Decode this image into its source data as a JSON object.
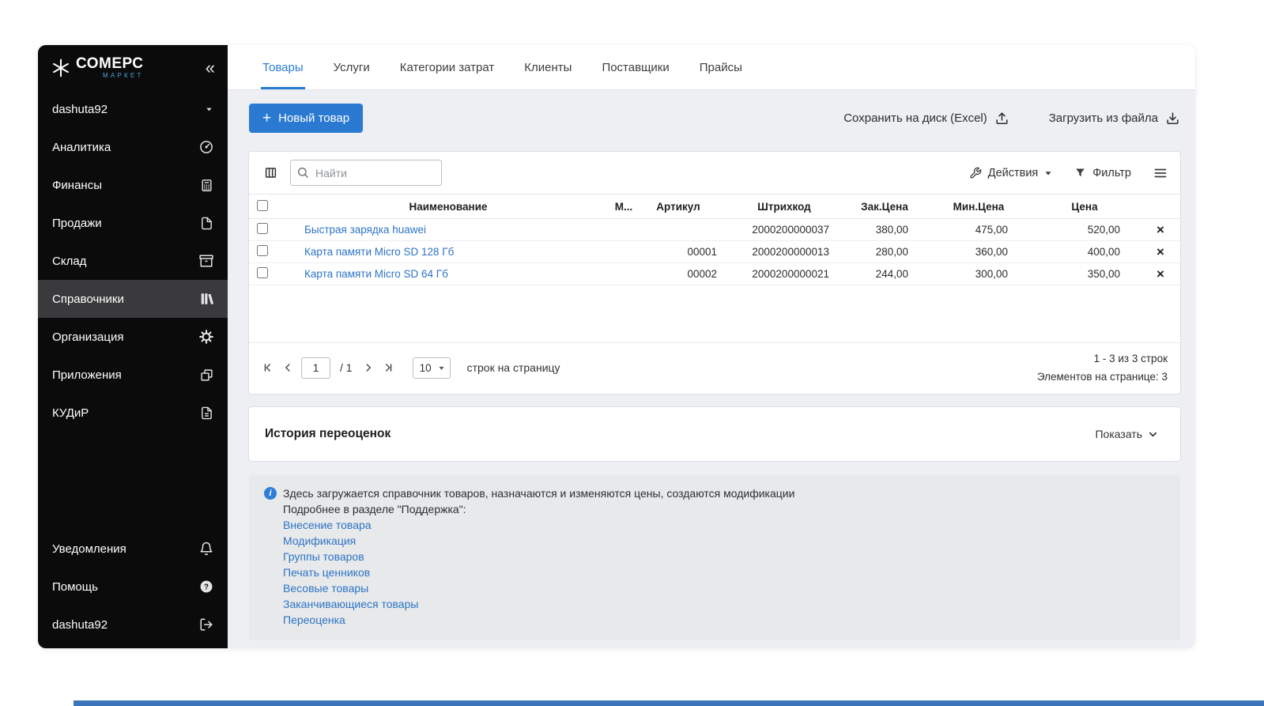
{
  "colors": {
    "accent": "#2b7cd3",
    "button_blue": "#2b7ad1",
    "link_blue": "#2d74c4",
    "sidebar_bg": "#0b0b0c",
    "info_box_bg": "#e7e9eb"
  },
  "sidebar": {
    "logo_title": "СОМЕРС",
    "logo_subtitle": "МАРКЕТ",
    "collapse_label": "«",
    "user_label": "dashuta92",
    "items": [
      {
        "label": "Аналитика",
        "icon": "gauge-icon"
      },
      {
        "label": "Финансы",
        "icon": "calculator-icon"
      },
      {
        "label": "Продажи",
        "icon": "document-icon"
      },
      {
        "label": "Склад",
        "icon": "archive-box-icon"
      },
      {
        "label": "Справочники",
        "icon": "books-icon",
        "active": true
      },
      {
        "label": "Организация",
        "icon": "gear-icon"
      },
      {
        "label": "Приложения",
        "icon": "apps-icon"
      },
      {
        "label": "КУДиР",
        "icon": "ledger-icon"
      }
    ],
    "bottom_items": [
      {
        "label": "Уведомления",
        "icon": "bell-icon"
      },
      {
        "label": "Помощь",
        "icon": "question-icon"
      },
      {
        "label": "dashuta92",
        "icon": "logout-icon"
      }
    ]
  },
  "tabs": [
    {
      "label": "Товары",
      "active": true
    },
    {
      "label": "Услуги"
    },
    {
      "label": "Категории затрат"
    },
    {
      "label": "Клиенты"
    },
    {
      "label": "Поставщики"
    },
    {
      "label": "Прайсы"
    }
  ],
  "actions": {
    "new_product_plus": "+",
    "new_product": "Новый товар",
    "save_excel": "Сохранить на диск (Excel)",
    "load_file": "Загрузить из файла"
  },
  "toolbar": {
    "search_placeholder": "Найти",
    "actions_label": "Действия",
    "filter_label": "Фильтр"
  },
  "table": {
    "headers": [
      "Наименование",
      "М...",
      "Артикул",
      "Штрихкод",
      "Зак.Цена",
      "Мин.Цена",
      "Цена"
    ],
    "delete_glyph": "×",
    "rows": [
      {
        "name": "Быстрая зарядка huawei",
        "mod": "",
        "article": "",
        "barcode": "2000200000037",
        "purchase_price": "380,00",
        "min_price": "475,00",
        "price": "520,00"
      },
      {
        "name": "Карта памяти Micro SD 128 Гб",
        "mod": "",
        "article": "00001",
        "barcode": "2000200000013",
        "purchase_price": "280,00",
        "min_price": "360,00",
        "price": "400,00"
      },
      {
        "name": "Карта памяти Micro SD 64 Гб",
        "mod": "",
        "article": "00002",
        "barcode": "2000200000021",
        "purchase_price": "244,00",
        "min_price": "300,00",
        "price": "350,00"
      }
    ]
  },
  "pagination": {
    "page": "1",
    "page_total_label": "/  1",
    "per_page": "10",
    "per_page_label": "строк на страницу",
    "rows_range": "1 - 3 из 3 строк",
    "per_page_info": "Элементов на странице: 3"
  },
  "history": {
    "title": "История переоценок",
    "toggle_label": "Показать"
  },
  "info": {
    "line1": "Здесь загружается справочник товаров, назначаются и изменяются цены, создаются модификации",
    "line2": "Подробнее в разделе \"Поддержка\":",
    "links": [
      "Внесение товара",
      "Модификация",
      "Группы товаров",
      "Печать ценников",
      "Весовые товары",
      "Заканчивающиеся товары",
      "Переоценка"
    ]
  }
}
